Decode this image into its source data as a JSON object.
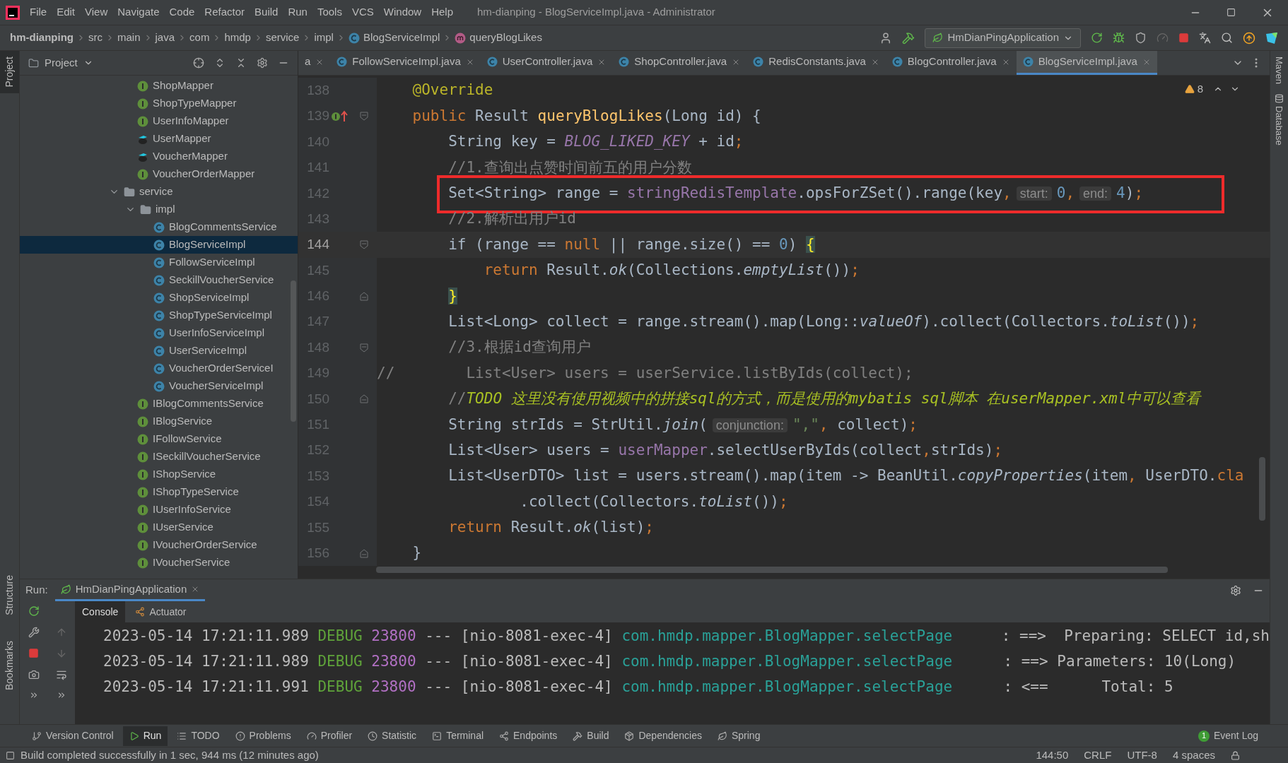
{
  "window": {
    "title": "hm-dianping - BlogServiceImpl.java - Administrator",
    "menu": [
      "File",
      "Edit",
      "View",
      "Navigate",
      "Code",
      "Refactor",
      "Build",
      "Run",
      "Tools",
      "VCS",
      "Window",
      "Help"
    ]
  },
  "breadcrumb": [
    {
      "label": "hm-dianping",
      "kind": "project"
    },
    {
      "label": "src",
      "kind": "dir"
    },
    {
      "label": "main",
      "kind": "dir"
    },
    {
      "label": "java",
      "kind": "dir"
    },
    {
      "label": "com",
      "kind": "dir"
    },
    {
      "label": "hmdp",
      "kind": "dir"
    },
    {
      "label": "service",
      "kind": "dir"
    },
    {
      "label": "impl",
      "kind": "dir"
    },
    {
      "label": "BlogServiceImpl",
      "kind": "class"
    },
    {
      "label": "queryBlogLikes",
      "kind": "method"
    }
  ],
  "toolbar": {
    "run_config": "HmDianPingApplication"
  },
  "left_strip": [
    {
      "label": "Project",
      "selected": true
    },
    {
      "label": "Structure",
      "selected": false
    },
    {
      "label": "Bookmarks",
      "selected": false
    }
  ],
  "right_strip": [
    "Maven",
    "Database"
  ],
  "project": {
    "title": "Project",
    "tree": [
      {
        "children": [
          {
            "label": "ShopMapper",
            "kind": "interface",
            "selected": false
          },
          {
            "label": "ShopTypeMapper",
            "kind": "interface",
            "selected": false
          },
          {
            "label": "UserInfoMapper",
            "kind": "interface",
            "selected": false
          },
          {
            "label": "UserMapper",
            "kind": "mapper",
            "selected": false
          },
          {
            "label": "VoucherMapper",
            "kind": "mapper",
            "selected": false
          },
          {
            "label": "VoucherOrderMapper",
            "kind": "interface",
            "selected": false
          }
        ]
      },
      {
        "label": "service",
        "kind": "folder",
        "expanded": true,
        "selected": false,
        "children": [
          {
            "label": "impl",
            "kind": "folder",
            "expanded": true,
            "selected": false,
            "children": [
              {
                "label": "BlogCommentsService",
                "kind": "class",
                "selected": false
              },
              {
                "label": "BlogServiceImpl",
                "kind": "class",
                "selected": true
              },
              {
                "label": "FollowServiceImpl",
                "kind": "class",
                "selected": false
              },
              {
                "label": "SeckillVoucherService",
                "kind": "class",
                "selected": false
              },
              {
                "label": "ShopServiceImpl",
                "kind": "class",
                "selected": false
              },
              {
                "label": "ShopTypeServiceImpl",
                "kind": "class",
                "selected": false
              },
              {
                "label": "UserInfoServiceImpl",
                "kind": "class",
                "selected": false
              },
              {
                "label": "UserServiceImpl",
                "kind": "class",
                "selected": false
              },
              {
                "label": "VoucherOrderServiceI",
                "kind": "class",
                "selected": false
              },
              {
                "label": "VoucherServiceImpl",
                "kind": "class",
                "selected": false
              }
            ]
          },
          {
            "label": "IBlogCommentsService",
            "kind": "interface",
            "selected": false
          },
          {
            "label": "IBlogService",
            "kind": "interface",
            "selected": false
          },
          {
            "label": "IFollowService",
            "kind": "interface",
            "selected": false
          },
          {
            "label": "ISeckillVoucherService",
            "kind": "interface",
            "selected": false
          },
          {
            "label": "IShopService",
            "kind": "interface",
            "selected": false
          },
          {
            "label": "IShopTypeService",
            "kind": "interface",
            "selected": false
          },
          {
            "label": "IUserInfoService",
            "kind": "interface",
            "selected": false
          },
          {
            "label": "IUserService",
            "kind": "interface",
            "selected": false
          },
          {
            "label": "IVoucherOrderService",
            "kind": "interface",
            "selected": false
          },
          {
            "label": "IVoucherService",
            "kind": "interface",
            "selected": false
          }
        ]
      }
    ]
  },
  "tabs": [
    {
      "label": "a",
      "kind": "clipped",
      "selected": false
    },
    {
      "label": "FollowServiceImpl.java",
      "kind": "file",
      "selected": false
    },
    {
      "label": "UserController.java",
      "kind": "file",
      "selected": false
    },
    {
      "label": "ShopController.java",
      "kind": "file",
      "selected": false
    },
    {
      "label": "RedisConstants.java",
      "kind": "file",
      "selected": false
    },
    {
      "label": "BlogController.java",
      "kind": "file",
      "selected": false
    },
    {
      "label": "BlogServiceImpl.java",
      "kind": "file",
      "selected": true
    }
  ],
  "editor": {
    "warnings": "8",
    "lines": [
      {
        "number": "138",
        "current": false,
        "highlighted": false,
        "implements": false,
        "fold_start": false,
        "fold_end": false,
        "tokens": [
          {
            "text": "    @Override",
            "kind": "annotation"
          }
        ]
      },
      {
        "number": "139",
        "current": false,
        "highlighted": false,
        "implements": true,
        "fold_start": true,
        "fold_end": false,
        "tokens": [
          {
            "text": "    public",
            "kind": "keyword"
          },
          {
            "text": " Result ",
            "kind": "plain"
          },
          {
            "text": "queryBlogLikes",
            "kind": "method"
          },
          {
            "text": "(Long id) {",
            "kind": "plain"
          }
        ]
      },
      {
        "number": "140",
        "current": false,
        "highlighted": false,
        "implements": false,
        "fold_start": false,
        "fold_end": false,
        "tokens": [
          {
            "text": "        String key = ",
            "kind": "plain"
          },
          {
            "text": "BLOG_LIKED_KEY",
            "kind": "constant"
          },
          {
            "text": " + id",
            "kind": "plain"
          },
          {
            "text": ";",
            "kind": "punct"
          }
        ]
      },
      {
        "number": "141",
        "current": false,
        "highlighted": false,
        "implements": false,
        "fold_start": false,
        "fold_end": false,
        "tokens": [
          {
            "text": "        //1.查询出点赞时间前五的用户分数",
            "kind": "comment"
          }
        ]
      },
      {
        "number": "142",
        "current": false,
        "highlighted": true,
        "implements": false,
        "fold_start": false,
        "fold_end": false,
        "tokens": [
          {
            "text": "        Set<String> range = ",
            "kind": "plain"
          },
          {
            "text": "stringRedisTemplate",
            "kind": "field"
          },
          {
            "text": ".opsForZSet().range(key",
            "kind": "plain"
          },
          {
            "text": ",",
            "kind": "punct"
          },
          {
            "text": "start:",
            "kind": "hint"
          },
          {
            "text": "0",
            "kind": "number"
          },
          {
            "text": ",",
            "kind": "punct"
          },
          {
            "text": "end:",
            "kind": "hint"
          },
          {
            "text": "4",
            "kind": "number"
          },
          {
            "text": ")",
            "kind": "plain"
          },
          {
            "text": ";",
            "kind": "punct"
          }
        ]
      },
      {
        "number": "143",
        "current": false,
        "highlighted": false,
        "implements": false,
        "fold_start": false,
        "fold_end": false,
        "tokens": [
          {
            "text": "        //2.解析出用户id",
            "kind": "comment"
          }
        ]
      },
      {
        "number": "144",
        "current": true,
        "highlighted": false,
        "implements": false,
        "fold_start": true,
        "fold_end": false,
        "tokens": [
          {
            "text": "        if (range == ",
            "kind": "plain"
          },
          {
            "text": "null",
            "kind": "keyword"
          },
          {
            "text": " || range.size() == ",
            "kind": "plain"
          },
          {
            "text": "0",
            "kind": "number"
          },
          {
            "text": ") ",
            "kind": "plain"
          },
          {
            "text": "{",
            "kind": "brace"
          }
        ]
      },
      {
        "number": "145",
        "current": false,
        "highlighted": false,
        "implements": false,
        "fold_start": false,
        "fold_end": false,
        "tokens": [
          {
            "text": "            return",
            "kind": "keyword"
          },
          {
            "text": " Result.",
            "kind": "plain"
          },
          {
            "text": "ok",
            "kind": "static"
          },
          {
            "text": "(Collections.",
            "kind": "plain"
          },
          {
            "text": "emptyList",
            "kind": "static"
          },
          {
            "text": "())",
            "kind": "plain"
          },
          {
            "text": ";",
            "kind": "punct"
          }
        ]
      },
      {
        "number": "146",
        "current": false,
        "highlighted": false,
        "implements": false,
        "fold_start": false,
        "fold_end": true,
        "tokens": [
          {
            "text": "        }",
            "kind": "brace"
          }
        ]
      },
      {
        "number": "147",
        "current": false,
        "highlighted": false,
        "implements": false,
        "fold_start": false,
        "fold_end": false,
        "tokens": [
          {
            "text": "        List<Long> collect = range.stream().map(Long::",
            "kind": "plain"
          },
          {
            "text": "valueOf",
            "kind": "static"
          },
          {
            "text": ").collect(Collectors.",
            "kind": "plain"
          },
          {
            "text": "toList",
            "kind": "static"
          },
          {
            "text": "())",
            "kind": "plain"
          },
          {
            "text": ";",
            "kind": "punct"
          }
        ]
      },
      {
        "number": "148",
        "current": false,
        "highlighted": false,
        "implements": false,
        "fold_start": true,
        "fold_end": false,
        "tokens": [
          {
            "text": "        //3.根据id查询用户",
            "kind": "comment"
          }
        ]
      },
      {
        "number": "149",
        "current": false,
        "highlighted": false,
        "implements": false,
        "fold_start": false,
        "fold_end": false,
        "tokens": [
          {
            "text": "//        List<User> users = userService.listByIds(collect);",
            "kind": "comment"
          }
        ]
      },
      {
        "number": "150",
        "current": false,
        "highlighted": false,
        "implements": false,
        "fold_start": false,
        "fold_end": true,
        "tokens": [
          {
            "text": "        //",
            "kind": "comment"
          },
          {
            "text": "TODO 这里没有使用视频中的拼接sql的方式，而是使用的mybatis sql脚本 在userMapper.xml中可以查看",
            "kind": "todo"
          }
        ]
      },
      {
        "number": "151",
        "current": false,
        "highlighted": false,
        "implements": false,
        "fold_start": false,
        "fold_end": false,
        "tokens": [
          {
            "text": "        String strIds = StrUtil.",
            "kind": "plain"
          },
          {
            "text": "join",
            "kind": "static"
          },
          {
            "text": "(",
            "kind": "plain"
          },
          {
            "text": "conjunction:",
            "kind": "hint"
          },
          {
            "text": "\",\"",
            "kind": "string"
          },
          {
            "text": ",",
            "kind": "punct"
          },
          {
            "text": " collect)",
            "kind": "plain"
          },
          {
            "text": ";",
            "kind": "punct"
          }
        ]
      },
      {
        "number": "152",
        "current": false,
        "highlighted": false,
        "implements": false,
        "fold_start": false,
        "fold_end": false,
        "tokens": [
          {
            "text": "        List<User> users = ",
            "kind": "plain"
          },
          {
            "text": "userMapper",
            "kind": "field"
          },
          {
            "text": ".selectUserByIds(collect",
            "kind": "plain"
          },
          {
            "text": ",",
            "kind": "punct"
          },
          {
            "text": "strIds)",
            "kind": "plain"
          },
          {
            "text": ";",
            "kind": "punct"
          }
        ]
      },
      {
        "number": "153",
        "current": false,
        "highlighted": false,
        "implements": false,
        "fold_start": false,
        "fold_end": false,
        "tokens": [
          {
            "text": "        List<UserDTO> list = users.stream().map(item -> BeanUtil.",
            "kind": "plain"
          },
          {
            "text": "copyProperties",
            "kind": "static"
          },
          {
            "text": "(item",
            "kind": "plain"
          },
          {
            "text": ",",
            "kind": "punct"
          },
          {
            "text": " UserDTO.",
            "kind": "plain"
          },
          {
            "text": "cla",
            "kind": "keyword"
          }
        ]
      },
      {
        "number": "154",
        "current": false,
        "highlighted": false,
        "implements": false,
        "fold_start": false,
        "fold_end": false,
        "tokens": [
          {
            "text": "                .collect(Collectors.",
            "kind": "plain"
          },
          {
            "text": "toList",
            "kind": "static"
          },
          {
            "text": "())",
            "kind": "plain"
          },
          {
            "text": ";",
            "kind": "punct"
          }
        ]
      },
      {
        "number": "155",
        "current": false,
        "highlighted": false,
        "implements": false,
        "fold_start": false,
        "fold_end": false,
        "tokens": [
          {
            "text": "        return",
            "kind": "keyword"
          },
          {
            "text": " Result.",
            "kind": "plain"
          },
          {
            "text": "ok",
            "kind": "static"
          },
          {
            "text": "(list)",
            "kind": "plain"
          },
          {
            "text": ";",
            "kind": "punct"
          }
        ]
      },
      {
        "number": "156",
        "current": false,
        "highlighted": false,
        "implements": false,
        "fold_start": false,
        "fold_end": true,
        "tokens": [
          {
            "text": "    }",
            "kind": "plain"
          }
        ]
      }
    ]
  },
  "run": {
    "label": "Run:",
    "config_tab": "HmDianPingApplication",
    "tabs": [
      {
        "label": "Console",
        "selected": true
      },
      {
        "label": "Actuator",
        "selected": false
      }
    ],
    "log": [
      {
        "time": "2023-05-14 17:21:11.989",
        "level": "DEBUG",
        "pid": "23800",
        "sep": "---",
        "thread": "[nio-8081-exec-4]",
        "logger": "com.hmdp.mapper.BlogMapper.selectPage",
        "message": ": ==>  Preparing: SELECT id,sh"
      },
      {
        "time": "2023-05-14 17:21:11.989",
        "level": "DEBUG",
        "pid": "23800",
        "sep": "---",
        "thread": "[nio-8081-exec-4]",
        "logger": "com.hmdp.mapper.BlogMapper.selectPage",
        "message": ": ==> Parameters: 10(Long)"
      },
      {
        "time": "2023-05-14 17:21:11.991",
        "level": "DEBUG",
        "pid": "23800",
        "sep": "---",
        "thread": "[nio-8081-exec-4]",
        "logger": "com.hmdp.mapper.BlogMapper.selectPage",
        "message": ": <==      Total: 5"
      }
    ]
  },
  "tool_bar": [
    {
      "label": "Version Control",
      "selected": false
    },
    {
      "label": "Run",
      "selected": true
    },
    {
      "label": "TODO",
      "selected": false
    },
    {
      "label": "Problems",
      "selected": false
    },
    {
      "label": "Profiler",
      "selected": false
    },
    {
      "label": "Statistic",
      "selected": false
    },
    {
      "label": "Terminal",
      "selected": false
    },
    {
      "label": "Endpoints",
      "selected": false
    },
    {
      "label": "Build",
      "selected": false
    },
    {
      "label": "Dependencies",
      "selected": false
    },
    {
      "label": "Spring",
      "selected": false
    }
  ],
  "event_log": {
    "label": "Event Log",
    "count": "1"
  },
  "status_bar": {
    "message": "Build completed successfully in 1 sec, 944 ms (12 minutes ago)",
    "items": [
      "144:50",
      "CRLF",
      "UTF-8",
      "4 spaces"
    ]
  }
}
